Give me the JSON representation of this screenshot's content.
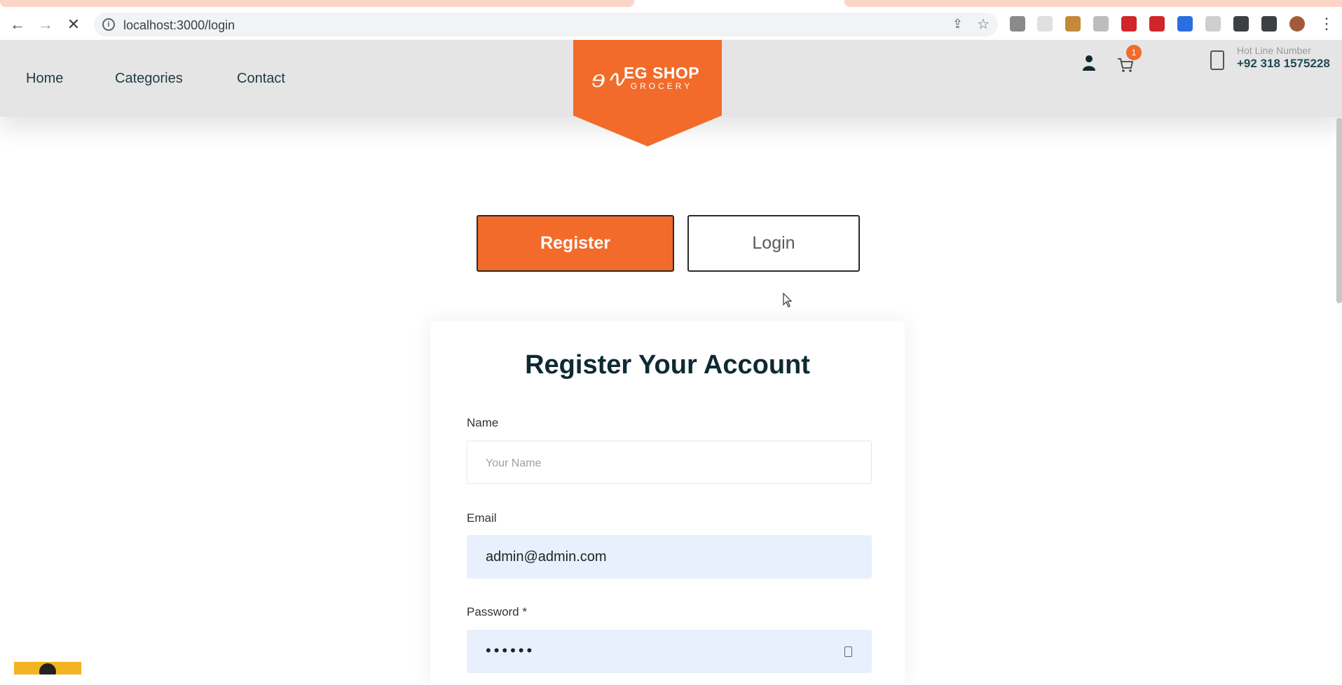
{
  "browser": {
    "url": "localhost:3000/login",
    "back_icon": "←",
    "forward_icon": "→",
    "stop_icon": "✕",
    "star_icon": "☆",
    "share_icon": "⇪",
    "menu_icon": "⋮",
    "extensions": [
      {
        "name": "ext-photo-icon",
        "color": "#8a8a8a"
      },
      {
        "name": "ext-blank-icon",
        "color": "#e0e0e0"
      },
      {
        "name": "ext-cookie-icon",
        "color": "#c48a3a"
      },
      {
        "name": "ext-arrow-icon",
        "color": "#bdbdbd"
      },
      {
        "name": "ext-lock-icon",
        "color": "#d0252b"
      },
      {
        "name": "ext-adblock-icon",
        "color": "#d0252b"
      },
      {
        "name": "ext-download-icon",
        "color": "#2a6fe0"
      },
      {
        "name": "ext-ball-icon",
        "color": "#cfcfcf"
      },
      {
        "name": "extensions-puzzle-icon",
        "color": "#3c4043"
      },
      {
        "name": "side-panel-icon",
        "color": "#3c4043"
      },
      {
        "name": "profile-avatar-icon",
        "color": "#a35a3a"
      }
    ]
  },
  "header": {
    "nav": [
      "Home",
      "Categories",
      "Contact"
    ],
    "logo": {
      "main": "EG SHOP",
      "sub": "GROCERY"
    },
    "cart_count": "1",
    "hotline_label": "Hot Line Number",
    "hotline_number": "+92 318 1575228",
    "accent_color": "#f26b2a"
  },
  "tabs": {
    "register_label": "Register",
    "login_label": "Login"
  },
  "form": {
    "title": "Register Your Account",
    "name_label": "Name",
    "name_placeholder": "Your Name",
    "email_label": "Email",
    "email_value": "admin@admin.com",
    "password_label": "Password *",
    "password_mask": "••••••"
  }
}
